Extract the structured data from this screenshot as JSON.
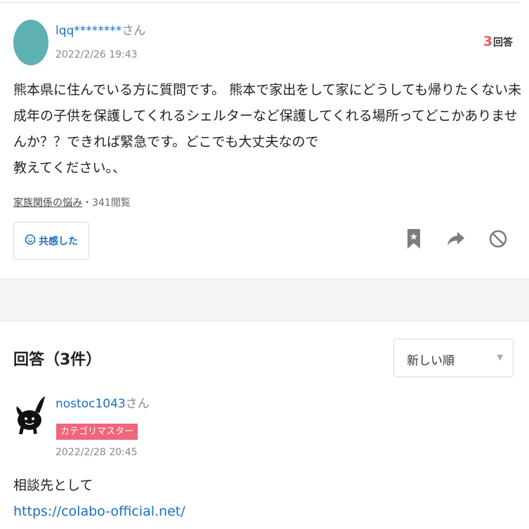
{
  "question": {
    "username": "lqq********",
    "honorific": "さん",
    "date": "2022/2/26 19:43",
    "answer_count": "3",
    "answer_count_label": "回答",
    "body_lines": [
      "熊本県に住んでいる方に質問です。 熊本で家出をして家にどうしても帰りたくない未",
      "成年の子供を保護してくれるシェルターなど保護してくれる場所ってどこかありませ",
      "んか？？できれば緊急です。どこでも大丈夫なので",
      "教えてください。、"
    ],
    "category": "家族関係の悩み",
    "views": "・341閲覧",
    "empathy_label": "共感した",
    "avatar_color": "#5fb0b3"
  },
  "answers_section": {
    "title": "回答（3件）",
    "sort": {
      "selected": "新しい順"
    }
  },
  "answer": {
    "username": "nostoc1043",
    "honorific": "さん",
    "badge": "カテゴリマスター",
    "date": "2022/2/28 20:45",
    "body_text": "相談先として",
    "link": "https://colabo-official.net/"
  },
  "icons": [
    "smile-icon",
    "bookmark-icon",
    "share-icon",
    "block-icon",
    "chevron-down-icon",
    "avatar-icon"
  ],
  "colors": {
    "link": "#1a6fc2",
    "accent_red": "#ee5a5a",
    "badge": "#f0667a"
  }
}
